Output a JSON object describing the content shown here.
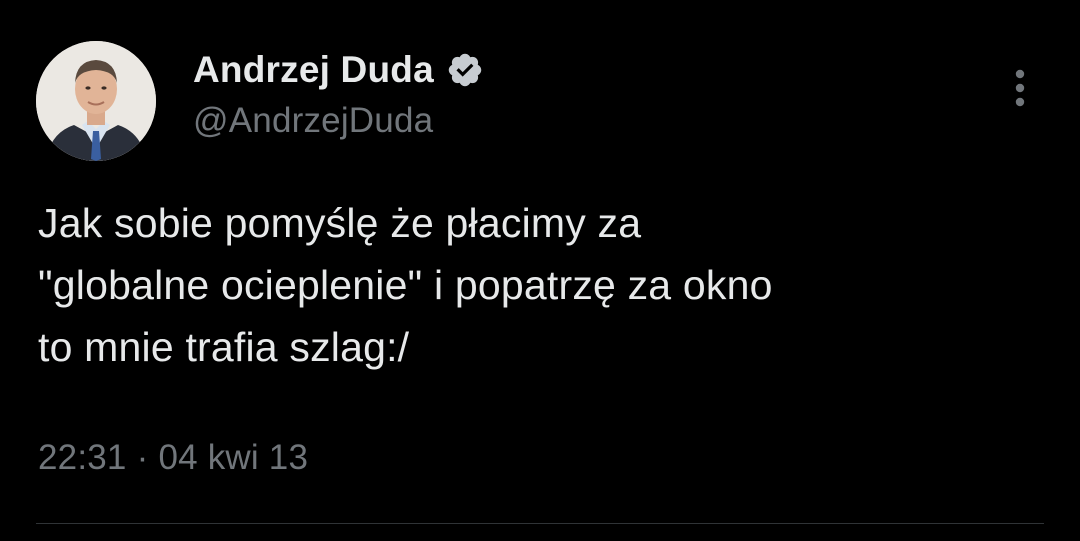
{
  "tweet": {
    "author": {
      "display_name": "Andrzej Duda",
      "handle": "@AndrzejDuda",
      "verified": true,
      "verified_icon": "verified-badge-icon"
    },
    "text": "Jak sobie pomyślę że płacimy za\n\"globalne ocieplenie\" i popatrzę za okno\nto mnie trafia szlag:/",
    "meta": {
      "time": "22:31",
      "separator": "·",
      "date": "04 kwi 13"
    },
    "more_icon": "more-vertical-icon"
  },
  "colors": {
    "background": "#000000",
    "primary_text": "#e7e9ea",
    "secondary_text": "#71767b",
    "divider": "#2f3336",
    "badge": "#c7ccd1"
  }
}
